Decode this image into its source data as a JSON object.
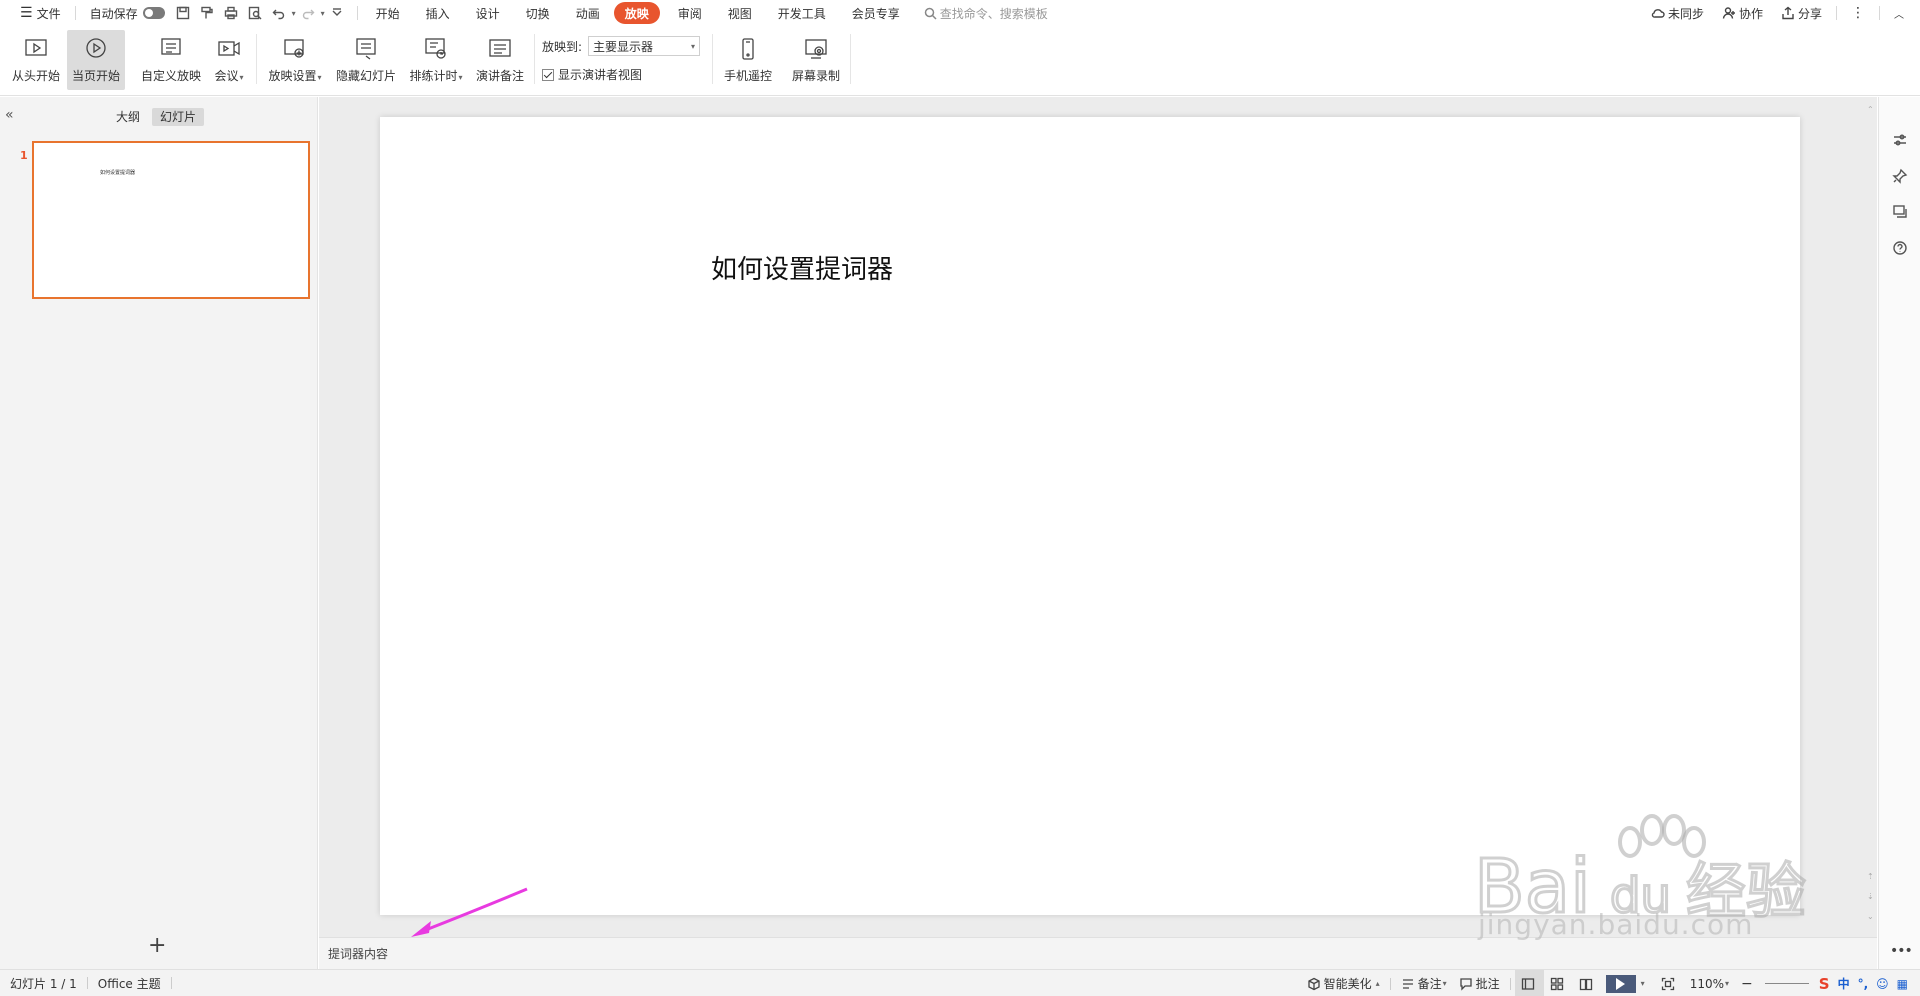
{
  "menubar": {
    "file": "文件",
    "autosave": "自动保存",
    "tabs": [
      {
        "label": "开始"
      },
      {
        "label": "插入"
      },
      {
        "label": "设计"
      },
      {
        "label": "切换"
      },
      {
        "label": "动画"
      },
      {
        "label": "放映",
        "active": true
      },
      {
        "label": "审阅"
      },
      {
        "label": "视图"
      },
      {
        "label": "开发工具"
      },
      {
        "label": "会员专享"
      }
    ],
    "search_placeholder": "查找命令、搜索模板",
    "sync": "未同步",
    "collab": "协作",
    "share": "分享"
  },
  "ribbon": {
    "from_start": "从头开始",
    "from_current": "当页开始",
    "custom_show": "自定义放映",
    "meeting": "会议",
    "show_settings": "放映设置",
    "hide_slide": "隐藏幻灯片",
    "rehearse": "排练计时",
    "speaker_notes": "演讲备注",
    "show_to_label": "放映到:",
    "show_to_value": "主要显示器",
    "presenter_view": "显示演讲者视图",
    "phone_remote": "手机遥控",
    "screen_record": "屏幕录制"
  },
  "leftpanel": {
    "tab_outline": "大纲",
    "tab_slides": "幻灯片",
    "slide_number": "1",
    "thumb_text": "如何设置提词器",
    "add": "+"
  },
  "slide": {
    "title": "如何设置提词器"
  },
  "notes": {
    "placeholder": "提词器内容"
  },
  "statusbar": {
    "slide_info": "幻灯片 1 / 1",
    "theme": "Office 主题",
    "beautify": "智能美化",
    "notes": "备注",
    "comments": "批注",
    "zoom": "110%",
    "ime_cn": "中"
  },
  "watermark": {
    "text": "jingyan.baidu.com"
  },
  "colors": {
    "accent": "#e8552e",
    "thumb_border": "#e8742e",
    "arrow": "#e83ae0"
  }
}
